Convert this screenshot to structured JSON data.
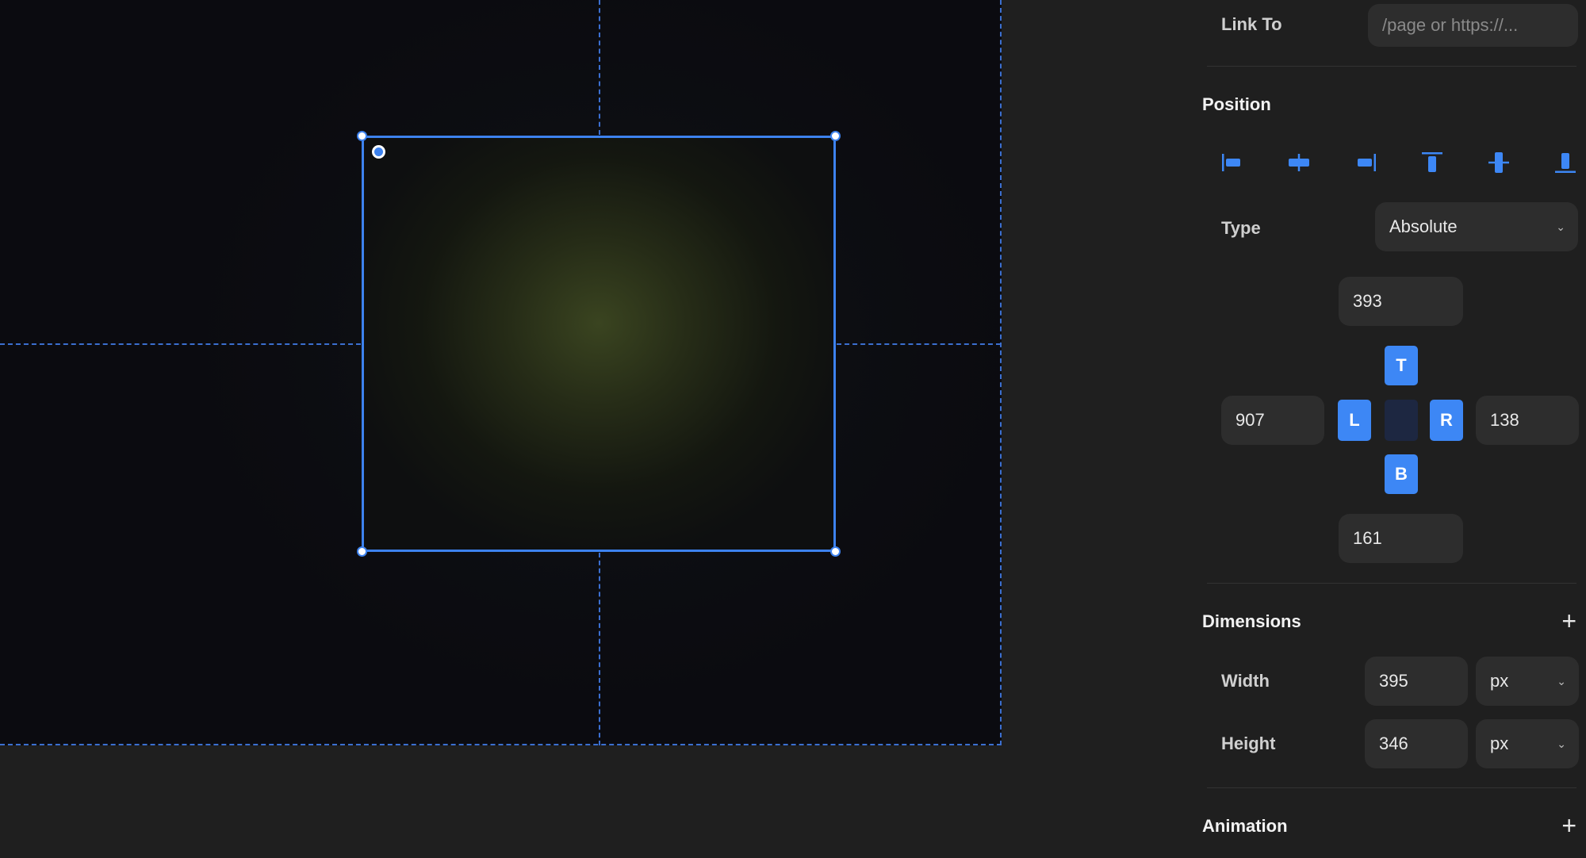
{
  "panel": {
    "link": {
      "label": "Link To",
      "placeholder": "/page or https://..."
    },
    "position": {
      "title": "Position",
      "align_icons": [
        "align-left-icon",
        "align-center-h-icon",
        "align-right-icon",
        "align-top-icon",
        "align-center-v-icon",
        "align-bottom-icon"
      ],
      "type_label": "Type",
      "type_value": "Absolute",
      "top_value": "393",
      "left_value": "907",
      "right_value": "138",
      "bottom_value": "161",
      "pins": {
        "top": "T",
        "left": "L",
        "right": "R",
        "bottom": "B"
      }
    },
    "dimensions": {
      "title": "Dimensions",
      "width_label": "Width",
      "width_value": "395",
      "width_unit": "px",
      "height_label": "Height",
      "height_value": "346",
      "height_unit": "px"
    },
    "animation": {
      "title": "Animation"
    },
    "add_symbol": "+"
  },
  "colors": {
    "accent": "#3d82ee",
    "panel_bg": "#1f1f1f",
    "field_bg": "#2d2d2d",
    "pin_active": "#3d87f5"
  }
}
